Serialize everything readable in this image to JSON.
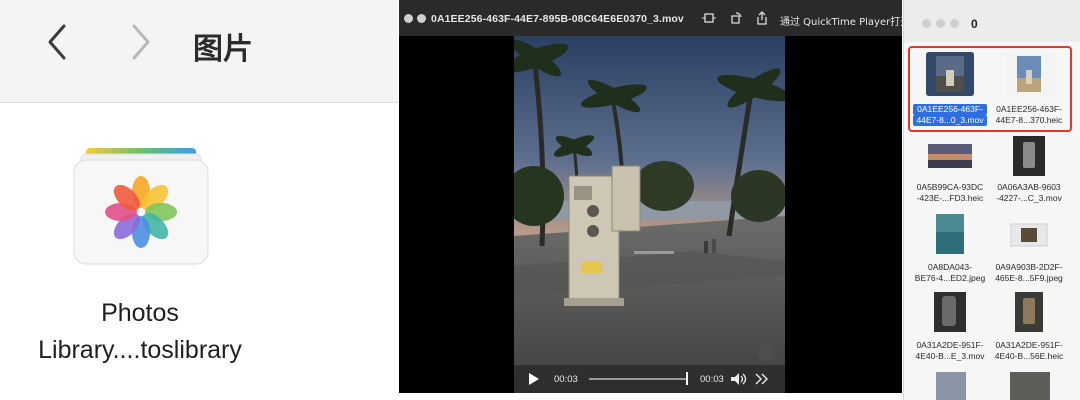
{
  "finder": {
    "title": "图片",
    "library": {
      "line1": "Photos",
      "line2": "Library....toslibrary"
    }
  },
  "player": {
    "filename": "0A1EE256-463F-44E7-895B-08C64E6E0370_3.mov",
    "open_with": "通过 QuickTime Player打开",
    "time_elapsed": "00:03",
    "time_remaining": "00:03"
  },
  "grid": {
    "window_count": "0",
    "items": [
      {
        "line1": "0A1EE256-463F-",
        "line2": "44E7-8...0_3.mov",
        "thumb": "beach-night",
        "selected": true
      },
      {
        "line1": "0A1EE256-463F-",
        "line2": "44E7-8...370.heic",
        "thumb": "beach-day",
        "selected": false
      },
      {
        "line1": "0A5B99CA-93DC",
        "line2": "-423E-...FD3.heic",
        "thumb": "sunset",
        "selected": false
      },
      {
        "line1": "0A06A3AB-9603",
        "line2": "-4227-...C_3.mov",
        "thumb": "phone-hand",
        "selected": false
      },
      {
        "line1": "0A8DA043-",
        "line2": "BE76-4...ED2.jpeg",
        "thumb": "water",
        "selected": false
      },
      {
        "line1": "0A9A903B-2D2F-",
        "line2": "465E-8...5F9.jpeg",
        "thumb": "photo-frame",
        "selected": false
      },
      {
        "line1": "0A31A2DE-951F-",
        "line2": "4E40-B...E_3.mov",
        "thumb": "phone-dark",
        "selected": false
      },
      {
        "line1": "0A31A2DE-951F-",
        "line2": "4E40-B...56E.heic",
        "thumb": "phone-dark2",
        "selected": false
      }
    ]
  },
  "colors": {
    "selection_blue": "#2e6ee0",
    "highlight_red": "#e0392c"
  }
}
